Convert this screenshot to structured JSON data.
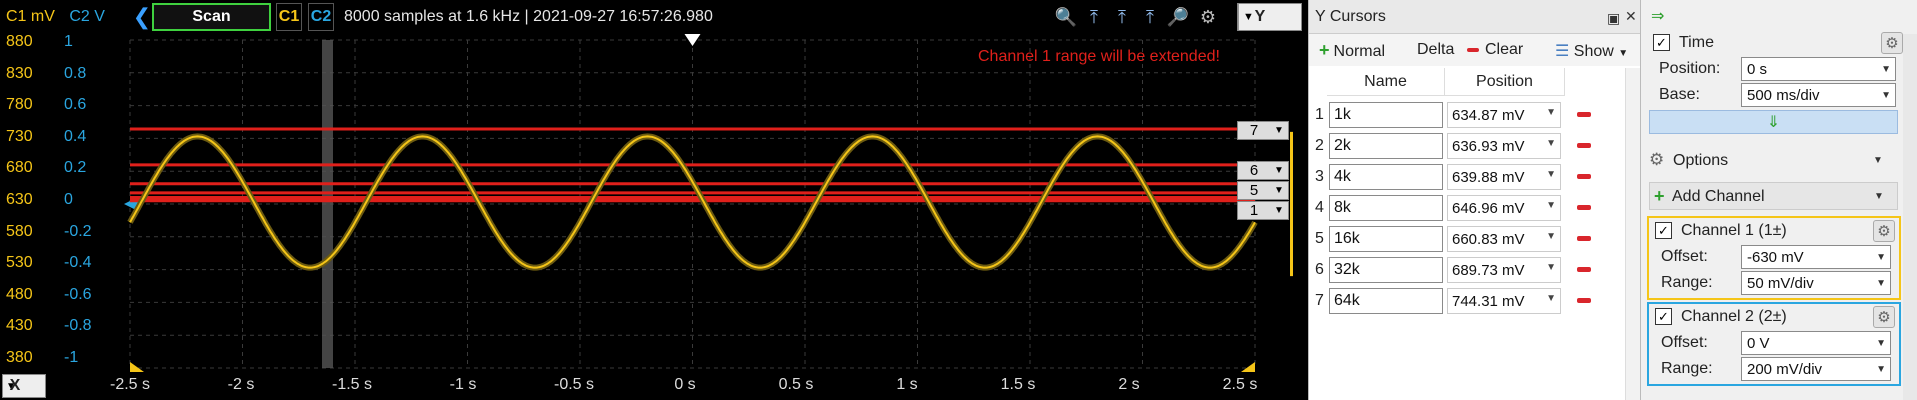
{
  "toolbar": {
    "scan_label": "Scan",
    "c1_label": "C1",
    "c2_label": "C2",
    "info": "8000 samples at 1.6 kHz | 2021-09-27 16:57:26.980",
    "y_select": "Y",
    "x_select": "X"
  },
  "axes": {
    "header_c1": "C1 mV",
    "header_c2": "C2 V",
    "c1_ticks": [
      "880",
      "830",
      "780",
      "730",
      "680",
      "630",
      "580",
      "530",
      "480",
      "430",
      "380"
    ],
    "c2_ticks": [
      "1",
      "0.8",
      "0.6",
      "0.4",
      "0.2",
      "0",
      "-0.2",
      "-0.4",
      "-0.6",
      "-0.8",
      "-1"
    ],
    "x_ticks": [
      "-2.5 s",
      "-2 s",
      "-1.5 s",
      "-1 s",
      "-0.5 s",
      "0 s",
      "0.5 s",
      "1 s",
      "1.5 s",
      "2 s",
      "2.5 s"
    ]
  },
  "warning": "Channel 1 range will be extended!",
  "cursor_tags": [
    "7",
    "6",
    "5",
    "1"
  ],
  "chart_data": {
    "type": "line",
    "x_range": [
      -2.5,
      2.5
    ],
    "y_range_mV": [
      380,
      880
    ],
    "signal": {
      "channel": "C1",
      "color": "#f5c518",
      "center_mV": 633,
      "amplitude_mV": 100,
      "period_s": 1.0,
      "peak_at_s": -2.2
    },
    "cursors_mV": [
      634.87,
      636.93,
      639.88,
      646.96,
      660.83,
      689.73,
      744.31
    ],
    "cursor_color": "#e0201b"
  },
  "ycursors": {
    "title": "Y Cursors",
    "normal_label": "Normal",
    "delta_label": "Delta",
    "clear_label": "Clear",
    "show_label": "Show",
    "col_name": "Name",
    "col_position": "Position",
    "rows": [
      {
        "idx": "1",
        "name": "1k",
        "pos": "634.87 mV"
      },
      {
        "idx": "2",
        "name": "2k",
        "pos": "636.93 mV"
      },
      {
        "idx": "3",
        "name": "4k",
        "pos": "639.88 mV"
      },
      {
        "idx": "4",
        "name": "8k",
        "pos": "646.96 mV"
      },
      {
        "idx": "5",
        "name": "16k",
        "pos": "660.83 mV"
      },
      {
        "idx": "6",
        "name": "32k",
        "pos": "689.73 mV"
      },
      {
        "idx": "7",
        "name": "64k",
        "pos": "744.31 mV"
      }
    ]
  },
  "settings": {
    "time_title": "Time",
    "position_label": "Position:",
    "position_value": "0 s",
    "base_label": "Base:",
    "base_value": "500 ms/div",
    "options_label": "Options",
    "add_channel_label": "Add Channel",
    "ch1_title": "Channel 1 (1±)",
    "ch1_offset_label": "Offset:",
    "ch1_offset_value": "-630 mV",
    "ch1_range_label": "Range:",
    "ch1_range_value": "50 mV/div",
    "ch1_color": "#f5c518",
    "ch2_title": "Channel 2 (2±)",
    "ch2_offset_label": "Offset:",
    "ch2_offset_value": "0 V",
    "ch2_range_label": "Range:",
    "ch2_range_value": "200 mV/div",
    "ch2_color": "#2aa6e0"
  }
}
